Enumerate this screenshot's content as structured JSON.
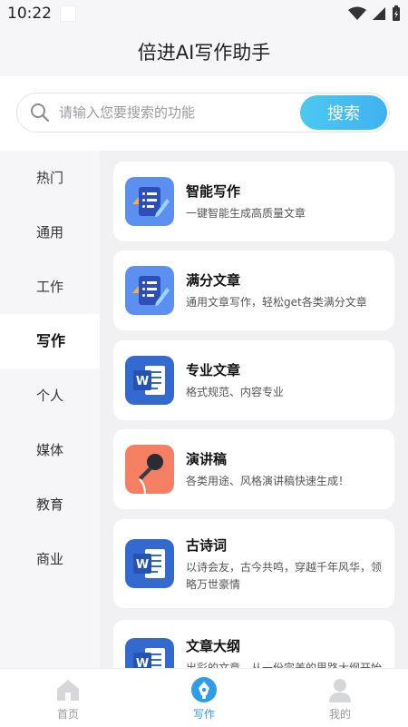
{
  "status_bar": {
    "time": "10:22"
  },
  "header": {
    "title": "倍进AI写作助手"
  },
  "search": {
    "placeholder": "请输入您要搜索的功能",
    "button_label": "搜索"
  },
  "sidebar": {
    "items": [
      {
        "label": "热门"
      },
      {
        "label": "通用"
      },
      {
        "label": "工作"
      },
      {
        "label": "写作",
        "active": true
      },
      {
        "label": "个人"
      },
      {
        "label": "媒体"
      },
      {
        "label": "教育"
      },
      {
        "label": "商业"
      }
    ]
  },
  "cards": [
    {
      "title": "智能写作",
      "desc": "一键智能生成高质量文章",
      "icon": "document-pencil-icon"
    },
    {
      "title": "满分文章",
      "desc": "通用文章写作，轻松get各类满分文章",
      "icon": "document-pencil-icon"
    },
    {
      "title": "专业文章",
      "desc": "格式规范、内容专业",
      "icon": "word-doc-icon"
    },
    {
      "title": "演讲稿",
      "desc": "各类用途、风格演讲稿快速生成！",
      "icon": "microphone-icon"
    },
    {
      "title": "古诗词",
      "desc": "以诗会友，古今共鸣，穿越千年风华，领略万世豪情",
      "icon": "word-doc-icon"
    },
    {
      "title": "文章大纲",
      "desc": "出彩的文章，从一份完美的思路大纲开始",
      "icon": "word-doc-icon"
    }
  ],
  "bottom_nav": {
    "items": [
      {
        "label": "首页",
        "icon": "home-icon"
      },
      {
        "label": "写作",
        "icon": "pen-icon",
        "active": true
      },
      {
        "label": "我的",
        "icon": "person-icon"
      }
    ]
  },
  "colors": {
    "accent": "#2f9ce8",
    "search_button": "#4cc9f0",
    "mic_bg": "#f47f62",
    "doc_blue": "#3469d0"
  }
}
